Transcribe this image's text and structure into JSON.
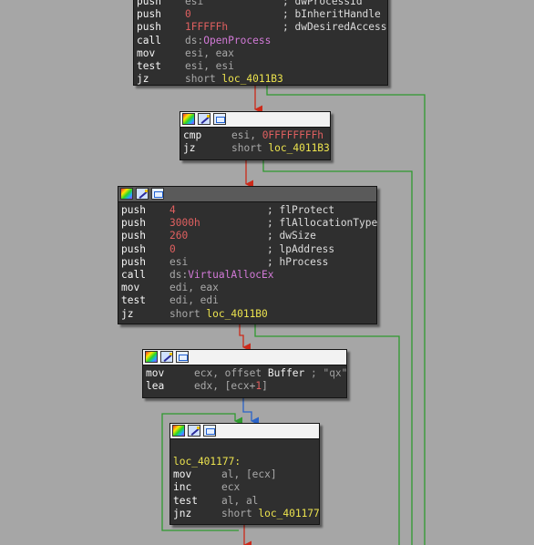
{
  "colors": {
    "background": "#a6a6a6",
    "node_background": "#2f2f2f",
    "edge_true": "#2f9a2f",
    "edge_false": "#cc2a1a",
    "edge_normal": "#2a63c8",
    "mnemonic": "#f5f5f5",
    "number": "#e06060",
    "symbol": "#d37ad8",
    "location": "#ece34e"
  },
  "header_icons": [
    "graph-overview-icon",
    "edit-node-icon",
    "node-picture-icon"
  ],
  "nodes": [
    {
      "id": "block-open-process",
      "lines": [
        {
          "mn": "push",
          "op": "esi",
          "cmt": "; dwProcessId"
        },
        {
          "mn": "push",
          "num": "0",
          "cmt": "; bInheritHandle"
        },
        {
          "mn": "push",
          "num": "1FFFFFh",
          "cmt": "; dwDesiredAccess"
        },
        {
          "mn": "call",
          "pre": "ds:",
          "sym": "OpenProcess"
        },
        {
          "mn": "mov",
          "op": "esi, eax"
        },
        {
          "mn": "test",
          "op": "esi, esi"
        },
        {
          "mn": "jz",
          "op": "short ",
          "loc": "loc_4011B3"
        }
      ]
    },
    {
      "id": "block-cmp",
      "lines": [
        {
          "mn": "cmp",
          "op": "esi, ",
          "num": "0FFFFFFFFh"
        },
        {
          "mn": "jz",
          "op": "short ",
          "loc": "loc_4011B3"
        }
      ]
    },
    {
      "id": "block-virtual-alloc",
      "lines": [
        {
          "mn": "push",
          "num": "4",
          "cmt": "; flProtect"
        },
        {
          "mn": "push",
          "num": "3000h",
          "cmt": "; flAllocationType"
        },
        {
          "mn": "push",
          "num": "260",
          "cmt": "; dwSize"
        },
        {
          "mn": "push",
          "num": "0",
          "cmt": "; lpAddress"
        },
        {
          "mn": "push",
          "op": "esi",
          "cmt": "; hProcess"
        },
        {
          "mn": "call",
          "pre": "ds:",
          "sym": "VirtualAllocEx"
        },
        {
          "mn": "mov",
          "op": "edi, eax"
        },
        {
          "mn": "test",
          "op": "edi, edi"
        },
        {
          "mn": "jz",
          "op": "short ",
          "loc": "loc_4011B0"
        }
      ]
    },
    {
      "id": "block-buffer",
      "lines": [
        {
          "mn": "mov",
          "op": "ecx, offset ",
          "lbl": "Buffer",
          "strc": " ; \"qx\""
        },
        {
          "mn": "lea",
          "op": "edx, [ecx+",
          "num": "1",
          "op2": "]"
        }
      ]
    },
    {
      "id": "block-loop",
      "lines": [
        {
          "label": "loc_401177:"
        },
        {
          "mn": "mov",
          "op": "al, [ecx]"
        },
        {
          "mn": "inc",
          "op": "ecx"
        },
        {
          "mn": "test",
          "op": "al, al"
        },
        {
          "mn": "jnz",
          "op": "short ",
          "loc": "loc_401177"
        }
      ]
    }
  ]
}
